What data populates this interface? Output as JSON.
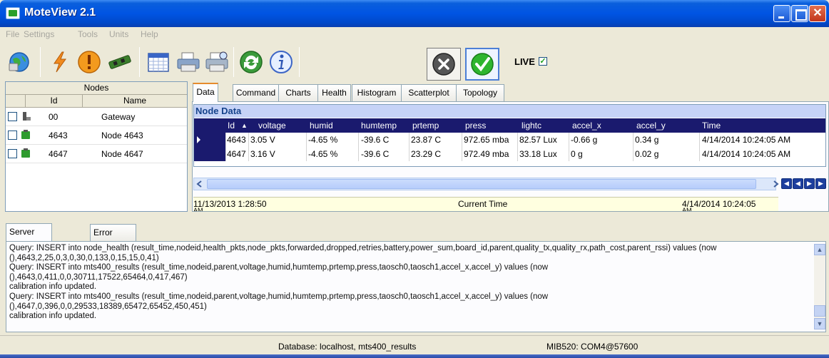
{
  "window": {
    "title": "MoteView 2.1"
  },
  "menu": [
    "File",
    "Settings",
    "Tools",
    "Units",
    "Help"
  ],
  "toolbar": {
    "icons": [
      "globe-icon",
      "lightning-icon",
      "warning-icon",
      "board-icon",
      "calendar-icon",
      "printer-icon",
      "print-preview-icon",
      "refresh-icon",
      "info-icon"
    ],
    "live_label": "LIVE"
  },
  "nodes": {
    "header": "Nodes",
    "columns": [
      "Id",
      "Name"
    ],
    "rows": [
      {
        "id": "00",
        "name": "Gateway"
      },
      {
        "id": "4643",
        "name": "Node 4643"
      },
      {
        "id": "4647",
        "name": "Node 4647"
      }
    ]
  },
  "tabs": [
    "Data",
    "Command",
    "Charts",
    "Health",
    "Histogram",
    "Scatterplot",
    "Topology"
  ],
  "grid": {
    "title": "Node Data",
    "columns": [
      "Id",
      "voltage",
      "humid",
      "humtemp",
      "prtemp",
      "press",
      "lightc",
      "accel_x",
      "accel_y",
      "Time"
    ],
    "sort_indicator": "▲",
    "rows": [
      [
        "4643",
        "3.05 V",
        "-4.65 %",
        "-39.6 C",
        "23.87 C",
        "972.65 mba",
        "82.57 Lux",
        "-0.66 g",
        "0.34 g",
        "4/14/2014 10:24:05 AM"
      ],
      [
        "4647",
        "3.16 V",
        "-4.65 %",
        "-39.6 C",
        "23.29 C",
        "972.49 mba",
        "33.18 Lux",
        "0 g",
        "0.02 g",
        "4/14/2014 10:24:05 AM"
      ]
    ]
  },
  "timeline": {
    "start": "11/13/2013 1:28:50",
    "start_suffix": "AM",
    "label": "Current Time",
    "end": "4/14/2014 10:24:05",
    "end_suffix": "AM"
  },
  "messages": {
    "tabs": [
      "Server Messages",
      "Error Messages"
    ],
    "lines": [
      "Query: INSERT into node_health (result_time,nodeid,health_pkts,node_pkts,forwarded,dropped,retries,battery,power_sum,board_id,parent,quality_tx,quality_rx,path_cost,parent_rssi) values (now",
      "(),4643,2,25,0,3,0,30,0,133,0,15,15,0,41)",
      "Query: INSERT into mts400_results (result_time,nodeid,parent,voltage,humid,humtemp,prtemp,press,taosch0,taosch1,accel_x,accel_y)  values (now",
      "(),4643,0,411,0,0,30711,17522,65464,0,417,467)",
      "calibration info updated.",
      "Query: INSERT into mts400_results (result_time,nodeid,parent,voltage,humid,humtemp,prtemp,press,taosch0,taosch1,accel_x,accel_y)  values (now",
      "(),4647,0,396,0,0,29533,18389,65472,65452,450,451)",
      "calibration info updated."
    ]
  },
  "status": {
    "database": "Database: localhost, mts400_results",
    "device": "MIB520: COM4@57600"
  },
  "colors": {
    "titlebar": "#0054e3",
    "grid_header": "#1a1a6e",
    "grid_title": "#c6d3f7",
    "timeline_bg": "#ffffe0"
  }
}
